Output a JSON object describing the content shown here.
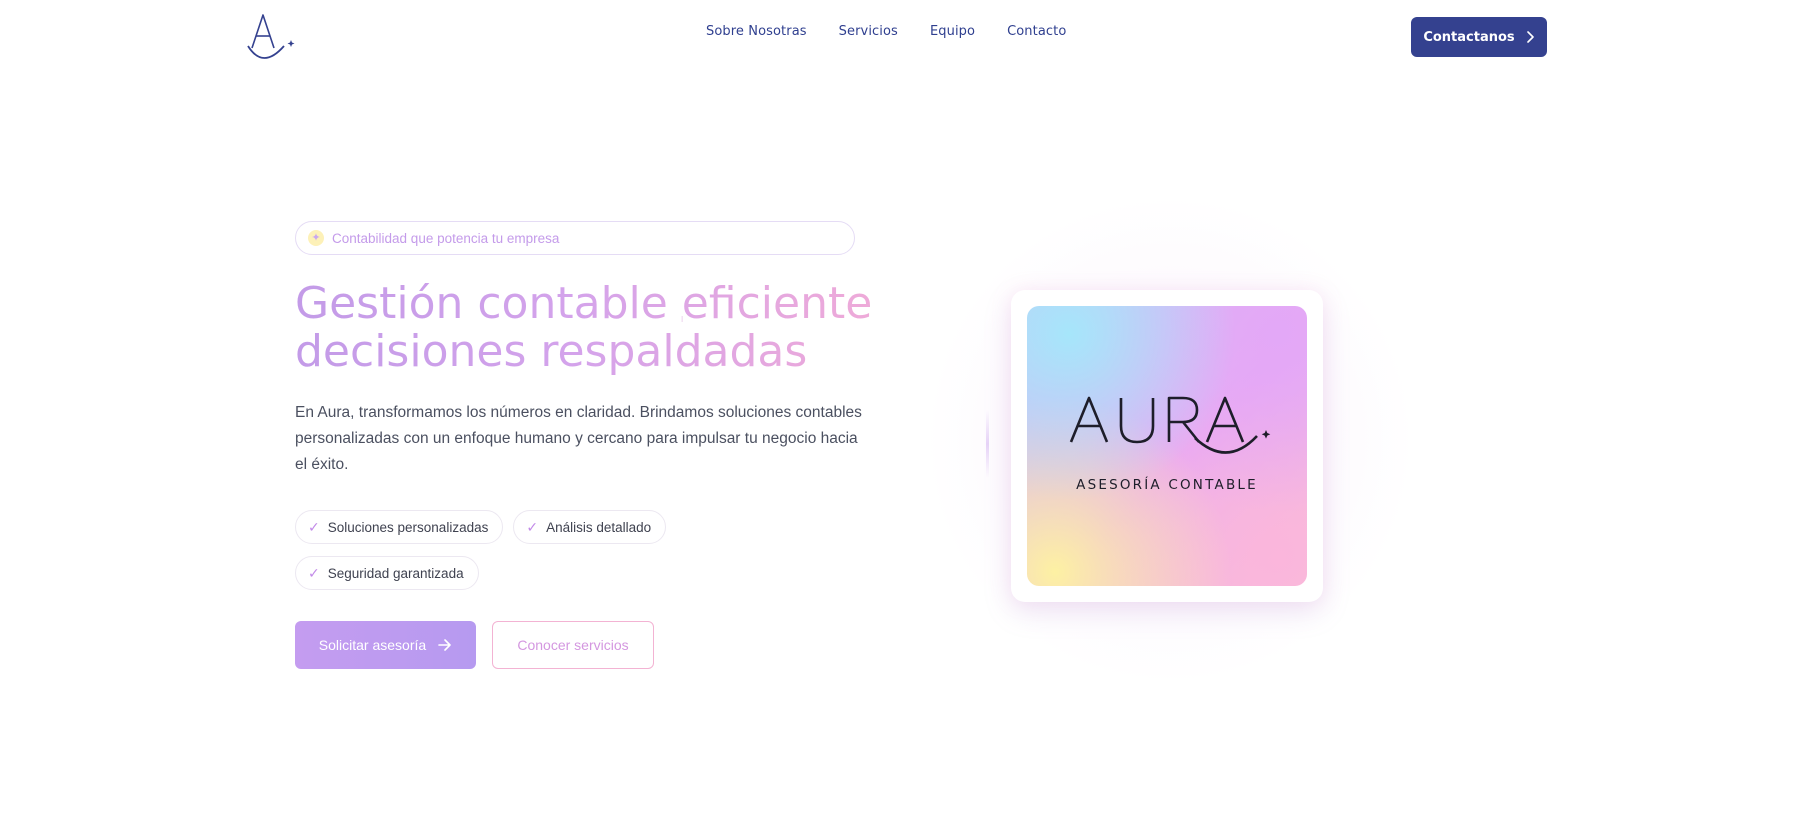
{
  "header": {
    "nav": [
      "Sobre Nosotras",
      "Servicios",
      "Equipo",
      "Contacto"
    ],
    "cta_label": "Contactanos"
  },
  "hero": {
    "badge": "Contabilidad que potencia tu empresa",
    "title_line1_a": "Gestión contable ",
    "title_line1_b": "eficiente",
    "title_line2": "decisiones respaldadas",
    "description": "En Aura, transformamos los números en claridad. Brindamos soluciones contables personalizadas con un enfoque humano y cercano para impulsar tu negocio hacia el éxito.",
    "features": [
      "Soluciones personalizadas",
      "Análisis detallado",
      "Seguridad garantizada"
    ],
    "primary_button": "Solicitar asesoría",
    "secondary_button": "Conocer servicios"
  },
  "card": {
    "brand": "AURA",
    "subtitle": "ASESORÍA CONTABLE"
  },
  "colors": {
    "primary": "#34418f",
    "accent_purple": "#c49cf0",
    "accent_pink": "#f2abd6"
  },
  "icons": {
    "badge": "sparkle-icon",
    "feature": "check-icon",
    "cta": "chevron-right-icon",
    "primary_button": "arrow-right-icon"
  }
}
